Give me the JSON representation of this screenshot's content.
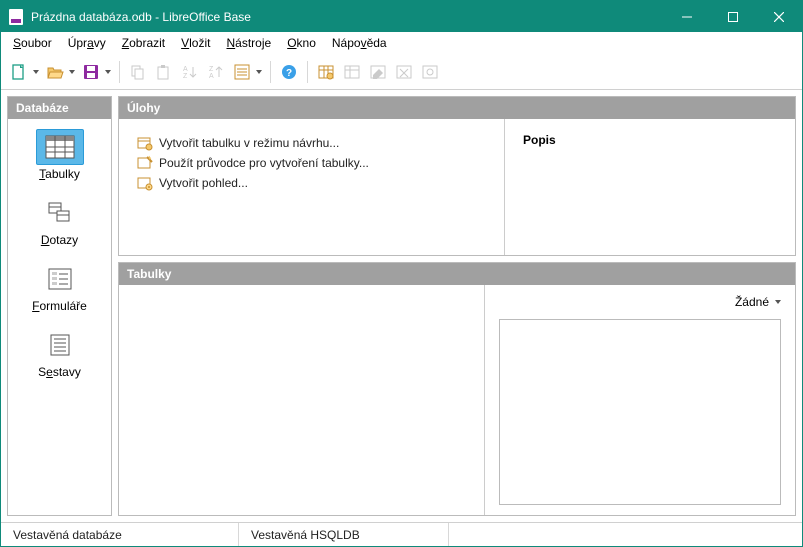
{
  "title": "Prázdna databáza.odb - LibreOffice Base",
  "menubar": {
    "soubor": "Soubor",
    "upravy": "Úpravy",
    "zobrazit": "Zobrazit",
    "vlozit": "Vložit",
    "nastroje": "Nástroje",
    "okno": "Okno",
    "napoveda": "Nápověda"
  },
  "sidebar": {
    "header": "Databáze",
    "items": [
      {
        "label": "Tabulky"
      },
      {
        "label": "Dotazy"
      },
      {
        "label": "Formuláře"
      },
      {
        "label": "Sestavy"
      }
    ]
  },
  "tasks": {
    "header": "Úlohy",
    "items": [
      "Vytvořit tabulku v režimu návrhu...",
      "Použít průvodce pro vytvoření tabulky...",
      "Vytvořit pohled..."
    ],
    "desc_label": "Popis"
  },
  "lower": {
    "header": "Tabulky",
    "view_mode": "Žádné"
  },
  "status": {
    "left": "Vestavěná databáze",
    "engine": "Vestavěná HSQLDB"
  }
}
